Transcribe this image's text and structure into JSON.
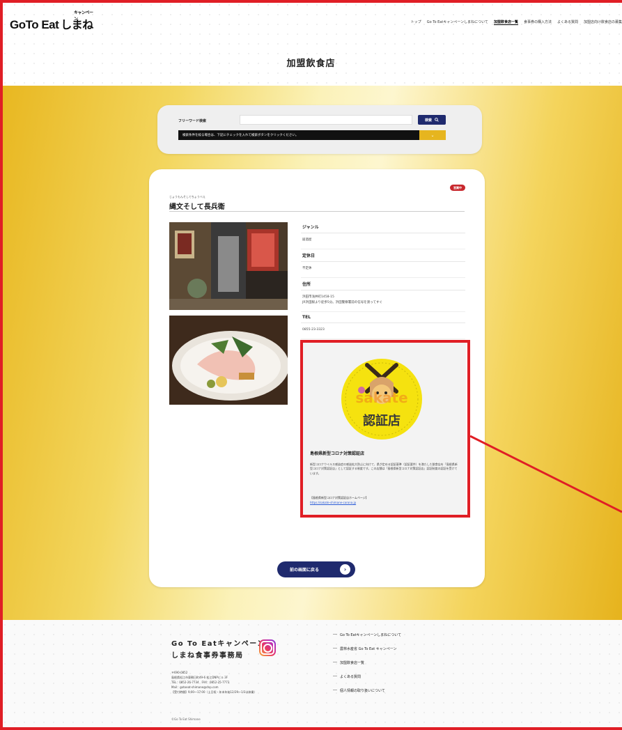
{
  "header": {
    "logo_main": "GoTo Eat",
    "logo_sub": "しまね",
    "logo_campaign": "キャンペーン",
    "nav": [
      {
        "label": "トップ"
      },
      {
        "label": "Go To Eatキャンペーンしまねについて"
      },
      {
        "label": "加盟飲食店一覧"
      },
      {
        "label": "食事券の購入方法"
      },
      {
        "label": "よくある質問"
      },
      {
        "label": "加盟店向け飲食店の募集"
      }
    ],
    "page_title": "加盟飲食店"
  },
  "search": {
    "label": "フリーワード検索",
    "value": "",
    "button_label": "検索",
    "filter_text": "検索条件を絞る場合は、下記にチェックを入れて検索ボタンをクリックください。",
    "toggle_icon": "chevron-down"
  },
  "store": {
    "badge": "営業中",
    "kana": "じょうもんそしてちょうべえ",
    "name": "縄文そして長兵衛",
    "fields": [
      {
        "label": "ジャンル",
        "value": "居酒屋"
      },
      {
        "label": "定休日",
        "value": "不定休"
      },
      {
        "label": "住所",
        "value": "浜田市浅井町1458-15",
        "note": "JR浜田駅より徒歩5分。浜田警察署前の信号を渡ってすぐ"
      },
      {
        "label": "TEL",
        "value": "0855-23-3323"
      }
    ],
    "certification": {
      "title": "島根県新型コロナ対策認証店",
      "text": "新型コロナウイルス感染症の感染拡大防止に向けて、県が定める認証基準（認証要件）を満たした飲食店を「島根県新型コロナ対策認証店」として認証する制度です。この店舗は「島根県新型コロナ対策認証店」認証制度の認証を受けています。",
      "link_label": "【島根県新型コロナ対策認証店ホームページ】",
      "link_url": "https://sakate-shimane-corona.jp",
      "seal_text": "認証店"
    },
    "back_button": "前の画面に戻る"
  },
  "footer": {
    "title_line1": "Go To Eatキャンペーン",
    "title_line2": "しまね食事券事務局",
    "address": "〒690-0852\n島根県松江市東朝日町49-6 松江DNPビル 3F\nTEL：0852-26-7734　FAX：0852-25-7773\nMail：gotoeat-shimane@dnp.com\n【受付時間】9:00〜17:00（土日祝・年末年始12/29〜1/3は休業）",
    "copyright": "©Go To Eat Shimane",
    "links": [
      {
        "label": "Go To Eatキャンペーンしまねについて"
      },
      {
        "label": "農林水産省 Go To Eat キャンペーン"
      },
      {
        "label": "加盟飲食店一覧"
      },
      {
        "label": "よくある質問"
      },
      {
        "label": "個人情報の取り扱いについて"
      }
    ]
  },
  "colors": {
    "highlight": "#e01e25",
    "navy": "#1f2a6e",
    "gold": "#e6b51f"
  }
}
